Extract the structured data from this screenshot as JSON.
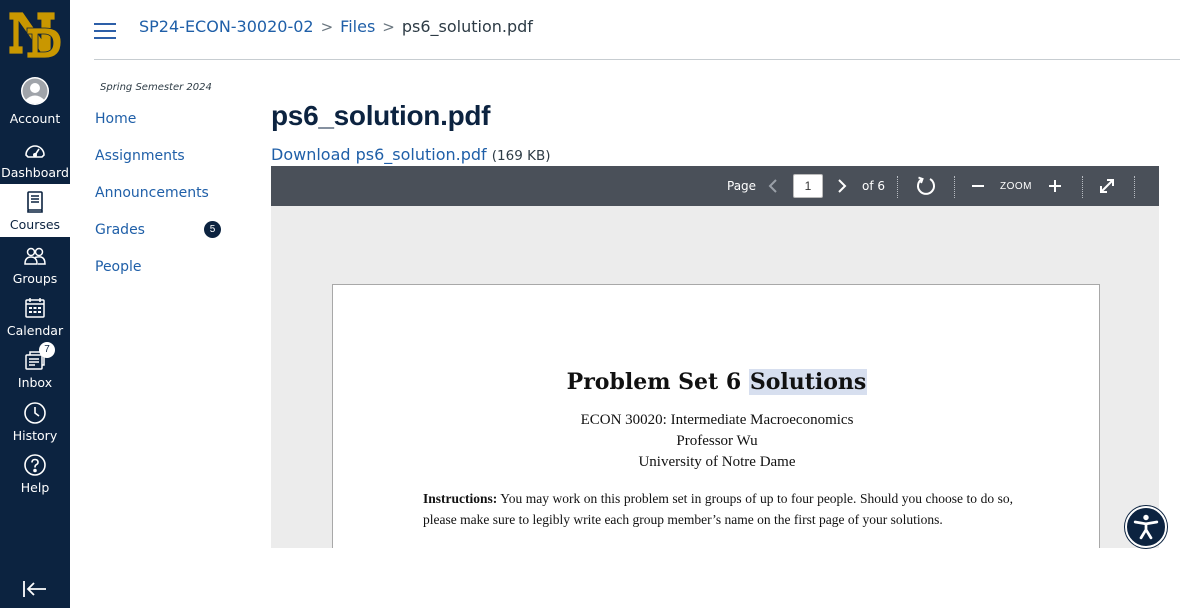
{
  "breadcrumb": {
    "course": "SP24-ECON-30020-02",
    "files": "Files",
    "file": "ps6_solution.pdf",
    "separator": ">"
  },
  "global_nav": {
    "items": [
      {
        "label": "Account",
        "icon": "account-avatar-icon"
      },
      {
        "label": "Dashboard",
        "icon": "dashboard-icon"
      },
      {
        "label": "Courses",
        "icon": "courses-icon"
      },
      {
        "label": "Groups",
        "icon": "groups-icon"
      },
      {
        "label": "Calendar",
        "icon": "calendar-icon"
      },
      {
        "label": "Inbox",
        "icon": "inbox-icon",
        "badge": "7"
      },
      {
        "label": "History",
        "icon": "history-icon"
      },
      {
        "label": "Help",
        "icon": "help-icon"
      }
    ],
    "active": "Courses"
  },
  "course_nav": {
    "term": "Spring Semester 2024",
    "items": [
      {
        "label": "Home"
      },
      {
        "label": "Assignments"
      },
      {
        "label": "Announcements"
      },
      {
        "label": "Grades",
        "badge": "5"
      },
      {
        "label": "People"
      }
    ]
  },
  "file": {
    "title": "ps6_solution.pdf",
    "download_label": "Download ps6_solution.pdf",
    "size": "(169 KB)"
  },
  "viewer": {
    "page_label": "Page",
    "current_page": "1",
    "of_pages": "of 6",
    "zoom_label": "ZOOM"
  },
  "pdf": {
    "title_main": "Problem Set 6",
    "title_highlight": "Solutions",
    "course_line": "ECON 30020: Intermediate Macroeconomics",
    "professor": "Professor Wu",
    "university": "University of Notre Dame",
    "instructions_label": "Instructions:",
    "instructions_text": " You may work on this problem set in groups of up to four people. Should you choose to do so, please make sure to legibly write each group member’s name on the first page of your solutions."
  },
  "colors": {
    "nav_bg": "#0c2340",
    "link": "#1f5fa8",
    "toolbar": "#4a5059",
    "highlight": "#d7dfef",
    "logo_gold": "#c99700"
  }
}
